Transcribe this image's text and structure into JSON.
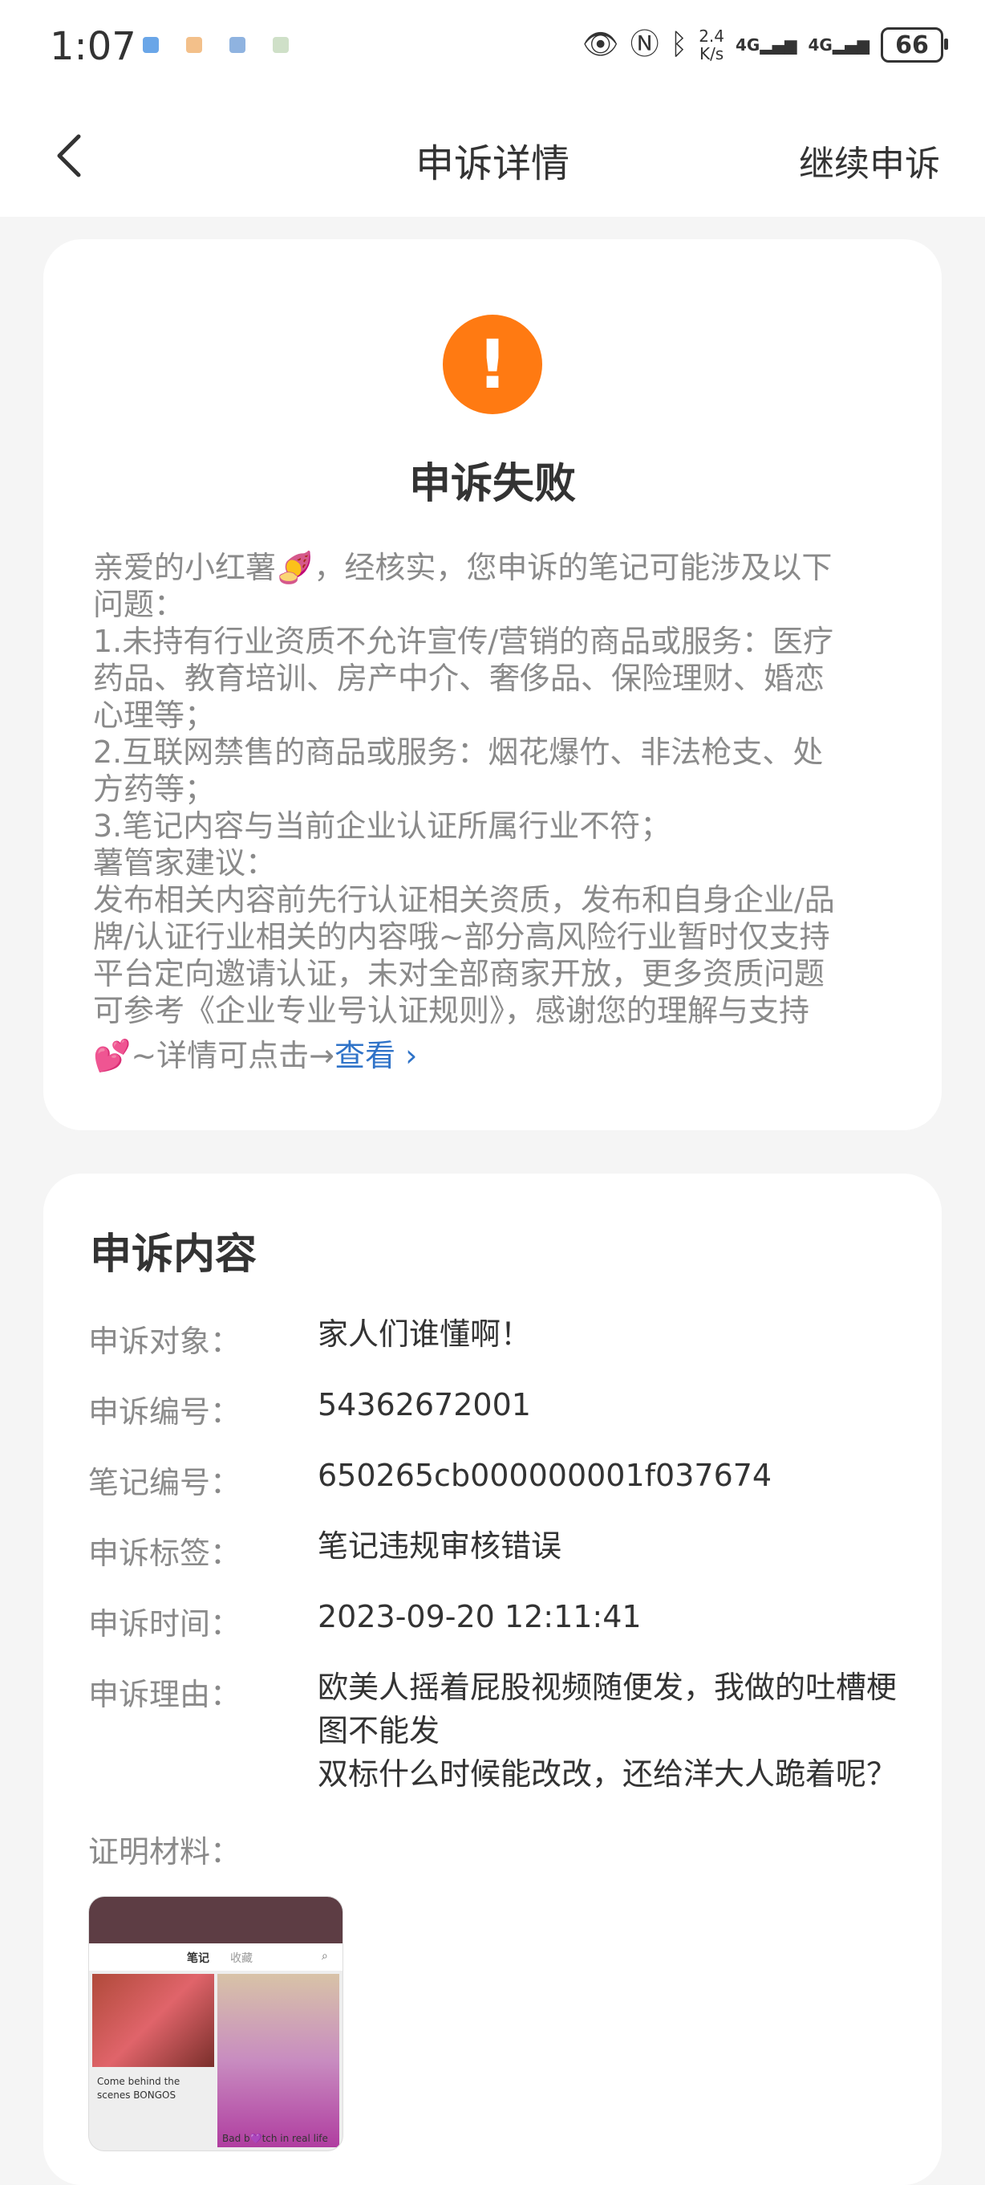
{
  "status_bar": {
    "time": "1:07",
    "speed_value": "2.4",
    "speed_unit": "K/s",
    "signal1": "4G",
    "signal2": "4G",
    "battery": "66"
  },
  "nav": {
    "title": "申诉详情",
    "action": "继续申诉"
  },
  "result": {
    "title": "申诉失败",
    "lines": [
      "亲爱的小红薯",
      "，经核实，您申诉的笔记可能涉及以下",
      "问题：",
      "1.未持有行业资质不允许宣传/营销的商品或服务：医疗",
      "药品、教育培训、房产中介、奢侈品、保险理财、婚恋",
      "心理等；",
      "2.互联网禁售的商品或服务：烟花爆竹、非法枪支、处",
      "方药等；",
      "3.笔记内容与当前企业认证所属行业不符；",
      "薯管家建议：",
      "发布相关内容前先行认证相关资质，发布和自身企业/品",
      "牌/认证行业相关的内容哦~部分高风险行业暂时仅支持",
      "平台定向邀请认证，未对全部商家开放，更多资质问题",
      "可参考《企业专业号认证规则》，感谢您的理解与支持",
      "~详情可点击→"
    ],
    "link_label": "查看 ›"
  },
  "content": {
    "title": "申诉内容",
    "fields": [
      {
        "label": "申诉对象：",
        "value": "家人们谁懂啊！"
      },
      {
        "label": "申诉编号：",
        "value": "54362672001"
      },
      {
        "label": "笔记编号：",
        "value": "650265cb000000001f037674"
      },
      {
        "label": "申诉标签：",
        "value": "笔记违规审核错误"
      },
      {
        "label": "申诉时间：",
        "value": "2023-09-20 12:11:41"
      }
    ],
    "reason_label": "申诉理由：",
    "reason_lines": [
      "欧美人摇着屁股视频随便发，我做的吐槽梗",
      "图不能发",
      "双标什么时候能改改，还给洋大人跪着呢？"
    ],
    "proof_label": "证明材料：",
    "proof_thumb": {
      "tab_notes": "笔记",
      "tab_collect": "收藏",
      "caption1": "Come behind the scenes BONGOS",
      "caption2": "Bad b💜tch in real life"
    }
  }
}
